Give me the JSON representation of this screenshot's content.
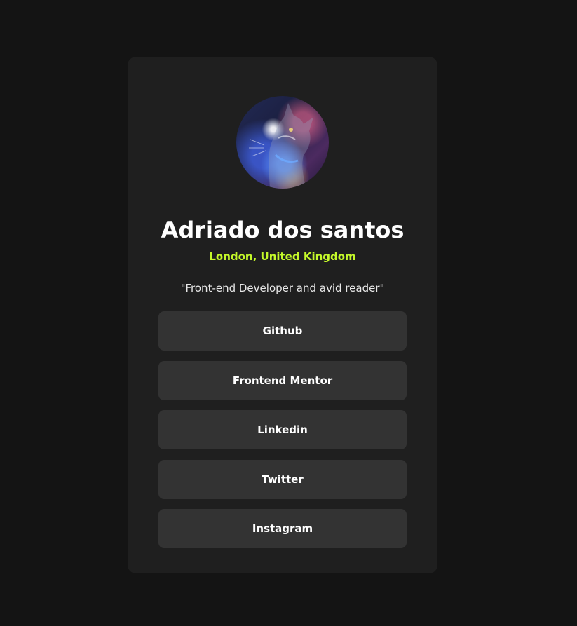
{
  "profile": {
    "avatar": "cat-portrait-image",
    "name": "Adriado dos santos",
    "location": "London, United Kingdom",
    "bio": "\"Front-end Developer and avid reader\""
  },
  "links": [
    {
      "label": "Github"
    },
    {
      "label": "Frontend Mentor"
    },
    {
      "label": "Linkedin"
    },
    {
      "label": "Twitter"
    },
    {
      "label": "Instagram"
    }
  ],
  "colors": {
    "page_background": "#141414",
    "card_background": "#1f1f1f",
    "button_background": "#333333",
    "accent": "#c4f82a",
    "text": "#ffffff"
  }
}
